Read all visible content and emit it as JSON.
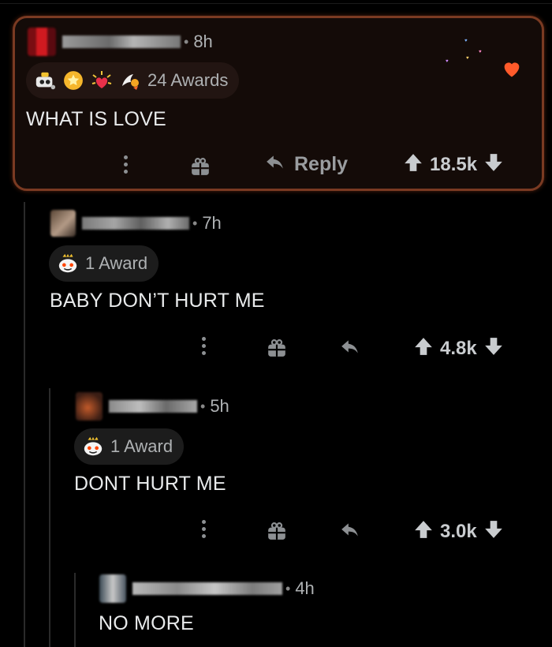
{
  "comments": [
    {
      "age": "8h",
      "awards_label": "24 Awards",
      "body": "WHAT IS LOVE",
      "reply_label": "Reply",
      "score": "18.5k"
    },
    {
      "age": "7h",
      "awards_label": "1 Award",
      "body": "BABY DON’T HURT ME",
      "score": "4.8k"
    },
    {
      "age": "5h",
      "awards_label": "1 Award",
      "body": "DONT HURT ME",
      "score": "3.0k"
    },
    {
      "age": "4h",
      "body": "NO MORE"
    }
  ],
  "colors": {
    "highlight_border": "#7a3a22",
    "highlight_bg": "#140b08",
    "background": "#000000"
  },
  "icons": [
    "kebab-menu-icon",
    "gift-icon",
    "reply-arrow-icon",
    "upvote-icon",
    "downvote-icon",
    "heart-icon"
  ]
}
